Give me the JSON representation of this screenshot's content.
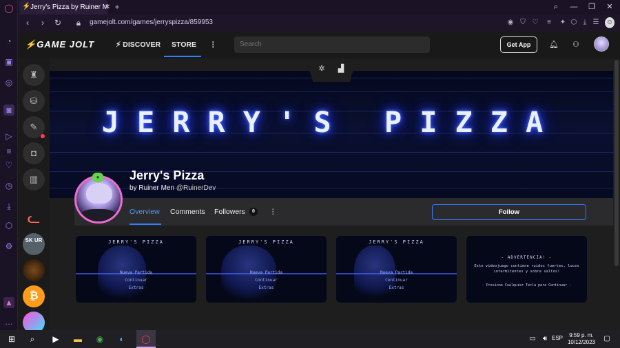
{
  "browser": {
    "tab_title": "Jerry's Pizza by Ruiner Men",
    "tab_close": "✕",
    "new_tab": "+",
    "url": "gamejolt.com/games/jerryspizza/859953"
  },
  "header": {
    "logo": "GAME JOLT",
    "nav": [
      {
        "label": "DISCOVER"
      },
      {
        "label": "STORE"
      }
    ],
    "more_icon": "⋮",
    "search_placeholder": "Search",
    "get_app_label": "Get App"
  },
  "banner": {
    "title": "JERRY'S PIZZA"
  },
  "game": {
    "title": "Jerry's Pizza",
    "by_prefix": "by",
    "developer": "Ruiner Men",
    "handle": "@RuinerDev"
  },
  "tabs": {
    "overview": "Overview",
    "comments": "Comments",
    "followers": "Followers",
    "followers_count": "0",
    "more": "⋮"
  },
  "follow_label": "Follow",
  "screenshots": [
    {
      "title": "JERRY'S PIZZA",
      "menu": [
        "Nueva Partida",
        "Continuar",
        "Extras"
      ]
    },
    {
      "title": "JERRY'S PIZZA",
      "menu": [
        "Nueva Partida",
        "Continuar",
        "Extras"
      ]
    },
    {
      "title": "JERRY'S PIZZA",
      "menu": [
        "Nueva Partida",
        "Continuar",
        "Extras"
      ]
    },
    {
      "title": "- ADVERTENCIA! -",
      "warning": "Este videojuego contiene ruidos fuertes, luces intermitentes y sobre saltos!",
      "prompt": "- Presione Cualquier Tecla para Continuar -"
    }
  ],
  "community_badge": "SK UR",
  "taskbar": {
    "lang": "ESP",
    "time": "9:59 p. m.",
    "date": "10/12/2023"
  },
  "colors": {
    "accent_blue": "#2f7fff",
    "neon_title": "#e9f0ff",
    "avatar_ring": "#f06ad0"
  }
}
